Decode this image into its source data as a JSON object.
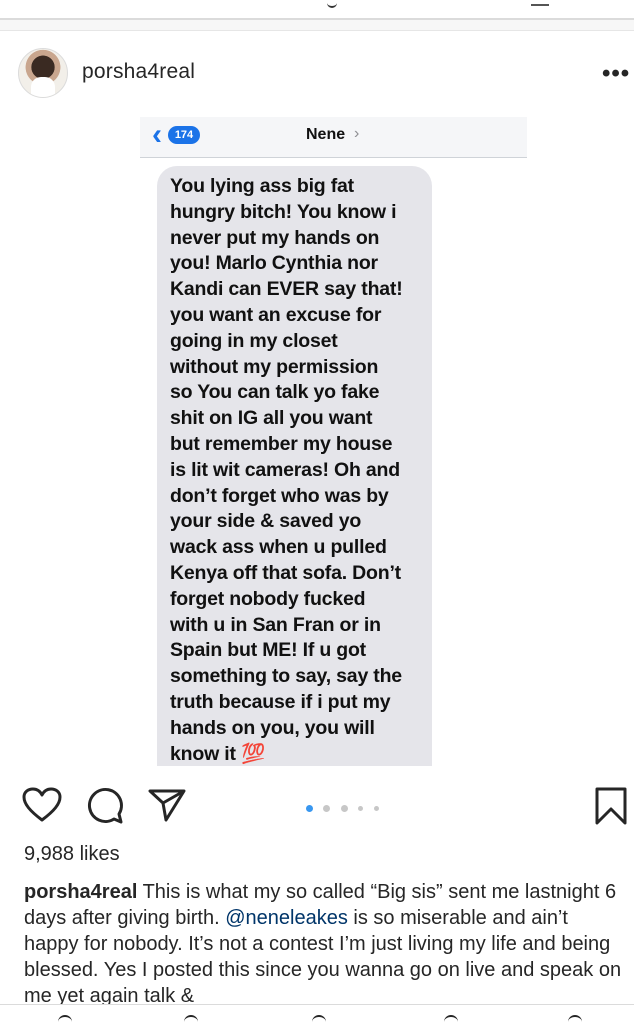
{
  "post": {
    "username": "porsha4real",
    "more_label": "•••"
  },
  "message_screenshot": {
    "back_badge": "174",
    "contact_name": "Nene",
    "message_text": "You lying ass big fat\nhungry bitch! You know i\nnever put my hands on\nyou! Marlo Cynthia nor\nKandi can EVER say that!\nyou want an excuse for\ngoing in my closet\nwithout my permission\nso You can talk yo fake\nshit on IG all you want\nbut remember my house\nis lit wit cameras! Oh and\ndon’t forget who was by\nyour side & saved yo\nwack ass when u pulled\nKenya off that sofa. Don’t\nforget nobody fucked\nwith u in San Fran or in\nSpain but ME! If u got\nsomething to say, say the\ntruth because if i put my\nhands on you, you will\nknow it 💯"
  },
  "actions": {
    "heart": "heart-icon",
    "comment": "comment-icon",
    "share": "share-icon",
    "bookmark": "bookmark-icon",
    "carousel_total": 5,
    "carousel_active": 1
  },
  "likes": "9,988 likes",
  "caption": {
    "username": "porsha4real",
    "text_before_mention": " This is what my so called “Big sis” sent me lastnight 6 days after giving birth. ",
    "mention": "@neneleakes",
    "text_after_mention": " is so miserable and ain’t happy for nobody. It’s not a contest I’m just living my life and being blessed. Yes I posted this since you wanna go on live and speak on me yet again talk &"
  },
  "colors": {
    "accent_blue": "#3897f0",
    "ios_blue": "#1b73e8",
    "bubble_gray": "#e5e5ea",
    "mention": "#003569"
  }
}
